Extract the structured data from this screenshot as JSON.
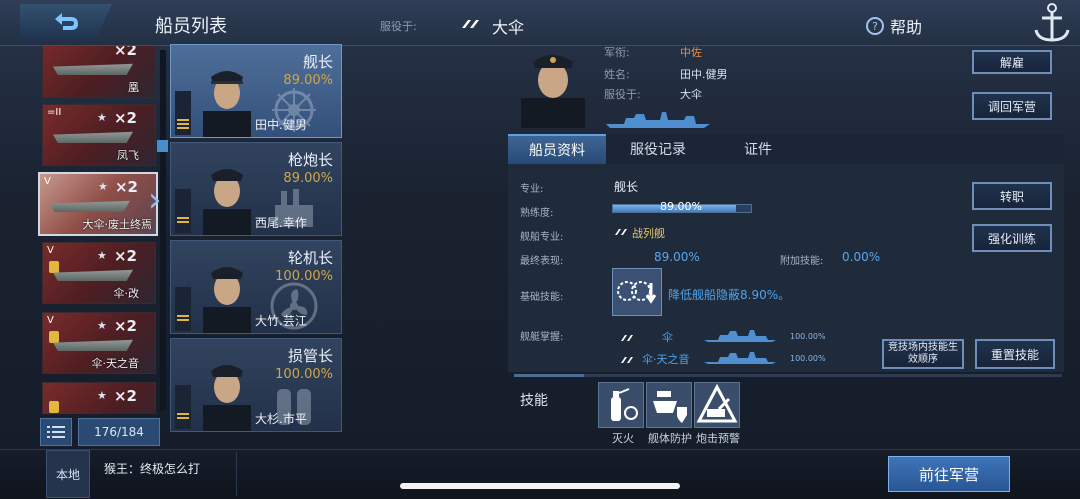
{
  "header": {
    "title": "船员列表",
    "serving_label": "服役于:",
    "serving_ship": "大伞",
    "help_label": "帮助",
    "help_icon": "question-circle-icon"
  },
  "ship_list": {
    "ships": [
      {
        "name": "凰",
        "stars": "×2",
        "tag": ""
      },
      {
        "name": "凤飞",
        "stars": "×2",
        "tag": "=II"
      },
      {
        "name": "大伞·废土终焉",
        "stars": "×2",
        "tag": "V",
        "selected": true
      },
      {
        "name": "伞·改",
        "stars": "×2",
        "tag": "V"
      },
      {
        "name": "伞·天之音",
        "stars": "×2",
        "tag": "V"
      },
      {
        "name": "",
        "stars": "×2",
        "tag": ""
      }
    ],
    "count": "176/184"
  },
  "crew": [
    {
      "role": "舰长",
      "pct": "89.00%",
      "name": "田中.健男",
      "selected": true
    },
    {
      "role": "枪炮长",
      "pct": "89.00%",
      "name": "西尾.幸作"
    },
    {
      "role": "轮机长",
      "pct": "100.00%",
      "name": "大竹.芸江"
    },
    {
      "role": "损管长",
      "pct": "100.00%",
      "name": "大杉.市平"
    }
  ],
  "officer": {
    "rank_label": "军衔:",
    "rank_value": "中佐",
    "name_label": "姓名:",
    "name_value": "田中.健男",
    "serving_label": "服役于:",
    "serving_value": "大伞"
  },
  "actions": {
    "dismiss": "解雇",
    "recall": "调回军营",
    "change_job": "转职",
    "train": "强化训练",
    "skill_order": "竞技场内技能生效顺序",
    "reset_skill": "重置技能"
  },
  "tabs": [
    "船员资料",
    "服役记录",
    "证件"
  ],
  "profile": {
    "specialty_label": "专业:",
    "specialty_value": "舰长",
    "proficiency_label": "熟练度:",
    "proficiency_value": "89.00%",
    "proficiency_fraction": 0.89,
    "ship_specialty_label": "舰船专业:",
    "ship_specialty_value": "战列舰",
    "final_perf_label": "最终表现:",
    "final_perf_value": "89.00%",
    "extra_skill_label": "附加技能:",
    "extra_skill_value": "0.00%",
    "base_skill_label": "基础技能:",
    "base_skill_desc": "降低舰船隐蔽8.90%。",
    "mastery_label": "舰艇掌握:",
    "mastery": [
      {
        "ship": "伞",
        "pct": "100.00%"
      },
      {
        "ship": "伞·天之音",
        "pct": "100.00%"
      }
    ]
  },
  "skills": {
    "title": "技能",
    "slots": [
      {
        "label": "灭火",
        "icon": "fire-extinguisher-icon"
      },
      {
        "label": "舰体防护",
        "icon": "ship-shield-icon"
      },
      {
        "label": "炮击预警",
        "icon": "shell-warning-icon"
      }
    ]
  },
  "chat": {
    "channel": "本地",
    "message": "猴王：终极怎么打"
  },
  "footer": {
    "goto_barracks": "前往军营"
  },
  "colors": {
    "accent": "#4fa3ec",
    "rank": "#f08a3c",
    "proficiency": "#d0a64a"
  }
}
